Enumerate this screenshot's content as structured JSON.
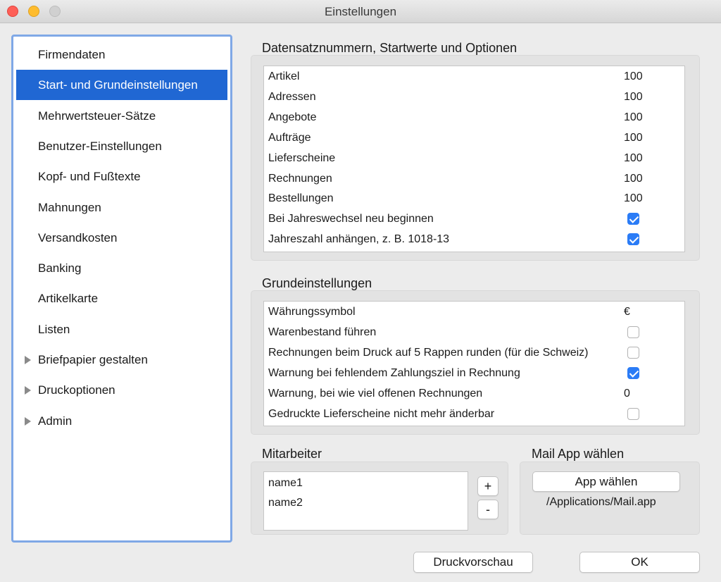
{
  "window": {
    "title": "Einstellungen"
  },
  "sidebar": {
    "items": [
      {
        "label": "Firmendaten",
        "selected": false,
        "expandable": false
      },
      {
        "label": "Start- und Grundeinstellungen",
        "selected": true,
        "expandable": false
      },
      {
        "label": "Mehrwertsteuer-Sätze",
        "selected": false,
        "expandable": false
      },
      {
        "label": "Benutzer-Einstellungen",
        "selected": false,
        "expandable": false
      },
      {
        "label": "Kopf- und Fußtexte",
        "selected": false,
        "expandable": false
      },
      {
        "label": "Mahnungen",
        "selected": false,
        "expandable": false
      },
      {
        "label": "Versandkosten",
        "selected": false,
        "expandable": false
      },
      {
        "label": "Banking",
        "selected": false,
        "expandable": false
      },
      {
        "label": "Artikelkarte",
        "selected": false,
        "expandable": false
      },
      {
        "label": "Listen",
        "selected": false,
        "expandable": false
      },
      {
        "label": "Briefpapier gestalten",
        "selected": false,
        "expandable": true
      },
      {
        "label": "Druckoptionen",
        "selected": false,
        "expandable": true
      },
      {
        "label": "Admin",
        "selected": false,
        "expandable": true
      }
    ]
  },
  "datensatz": {
    "title": "Datensatznummern, Startwerte und Optionen",
    "rows": [
      {
        "label": "Artikel",
        "value": "100"
      },
      {
        "label": "Adressen",
        "value": "100"
      },
      {
        "label": "Angebote",
        "value": "100"
      },
      {
        "label": "Aufträge",
        "value": "100"
      },
      {
        "label": "Lieferscheine",
        "value": "100"
      },
      {
        "label": "Rechnungen",
        "value": "100"
      },
      {
        "label": "Bestellungen",
        "value": "100"
      },
      {
        "label": "Bei Jahreswechsel neu beginnen",
        "checked": true
      },
      {
        "label": "Jahreszahl anhängen, z. B. 1018-13",
        "checked": true
      }
    ]
  },
  "grund": {
    "title": "Grundeinstellungen",
    "rows": [
      {
        "label": "Währungssymbol",
        "value": "€"
      },
      {
        "label": "Warenbestand führen",
        "checked": false
      },
      {
        "label": "Rechnungen beim Druck auf 5 Rappen runden (für die Schweiz)",
        "checked": false
      },
      {
        "label": "Warnung bei fehlendem Zahlungsziel in Rechnung",
        "checked": true
      },
      {
        "label": "Warnung, bei wie viel offenen Rechnungen",
        "value": "0"
      },
      {
        "label": "Gedruckte Lieferscheine nicht mehr änderbar",
        "checked": false
      }
    ]
  },
  "mitarbeiter": {
    "title": "Mitarbeiter",
    "names": [
      "name1",
      "name2"
    ],
    "add_label": "+",
    "remove_label": "-"
  },
  "mail": {
    "title": "Mail App wählen",
    "button_label": "App wählen",
    "path": "/Applications/Mail.app"
  },
  "footer": {
    "preview_label": "Druckvorschau",
    "ok_label": "OK"
  },
  "colors": {
    "accent": "#2067d3",
    "checkbox": "#2b7cf6",
    "sidebar_border": "#7fa8e6"
  }
}
